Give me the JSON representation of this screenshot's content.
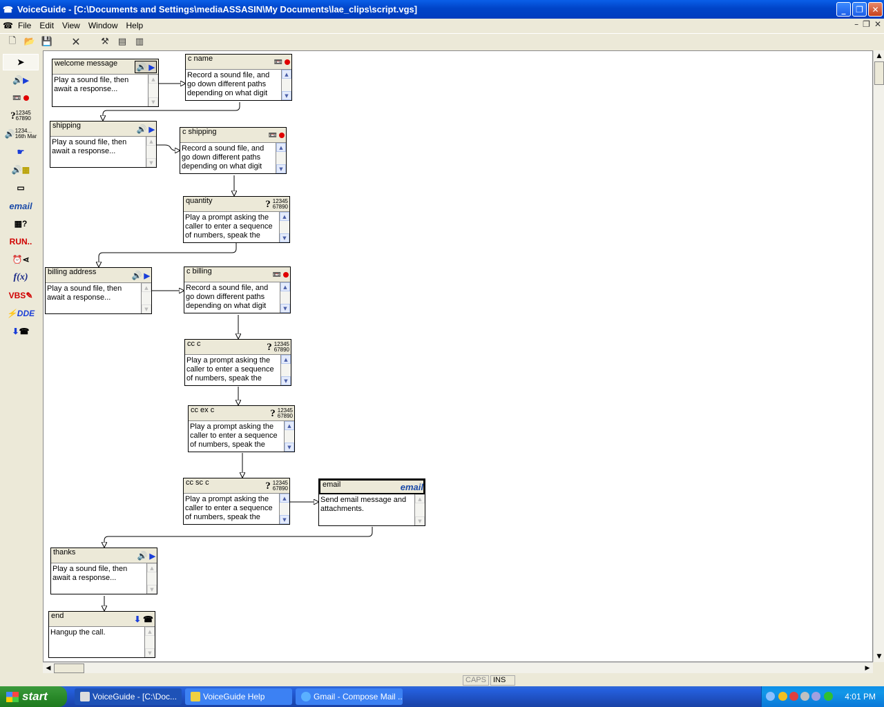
{
  "window": {
    "title": "VoiceGuide - [C:\\Documents and Settings\\mediaASSASIN\\My Documents\\lae_clips\\script.vgs]"
  },
  "menu": {
    "file": "File",
    "edit": "Edit",
    "view": "View",
    "window": "Window",
    "help": "Help"
  },
  "palette": {
    "email_label": "email",
    "run_label": "RUN..",
    "fx_label": "f(x)",
    "vbs_label": "VBS",
    "dde_label": "DDE",
    "nums_top": "12345",
    "nums_bottom": "67890",
    "time_top": "1234...",
    "time_bottom": "16th Mar"
  },
  "nodes": {
    "welcome": {
      "title": "welcome message",
      "desc": "Play a sound file, then await a response..."
    },
    "c_name": {
      "title": "c name",
      "desc": "Record a sound file, and go down different paths depending on what digit"
    },
    "shipping": {
      "title": "shipping",
      "desc": "Play a sound file, then await a response..."
    },
    "c_shipping": {
      "title": "c shipping",
      "desc": "Record a sound file, and go down different paths depending on what digit"
    },
    "quantity": {
      "title": "quantity",
      "desc": "Play a prompt asking the caller to enter a sequence of numbers, speak the"
    },
    "billing": {
      "title": "billing address",
      "desc": "Play a sound file, then await a response..."
    },
    "c_billing": {
      "title": "c billing",
      "desc": "Record a sound file, and go down different paths depending on what digit"
    },
    "cc_c": {
      "title": "cc c",
      "desc": "Play a prompt asking the caller to enter a sequence of numbers, speak the"
    },
    "cc_ex_c": {
      "title": "cc ex c",
      "desc": "Play a prompt asking the caller to enter a sequence of numbers, speak the"
    },
    "cc_sc_c": {
      "title": "cc sc c",
      "desc": "Play a prompt asking the caller to enter a sequence of numbers, speak the"
    },
    "email": {
      "title": "email",
      "desc": "Send email message and attachments.",
      "icon_label": "email"
    },
    "thanks": {
      "title": "thanks",
      "desc": "Play a sound file, then await a response..."
    },
    "end": {
      "title": "end",
      "desc": "Hangup the call."
    }
  },
  "digits": {
    "top": "12345",
    "bottom": "67890"
  },
  "status": {
    "caps": "CAPS",
    "ins": "INS"
  },
  "taskbar": {
    "start": "start",
    "tasks": [
      "VoiceGuide - [C:\\Doc...",
      "VoiceGuide Help",
      "Gmail - Compose Mail ..."
    ],
    "clock": "4:01 PM"
  },
  "colors": {
    "titlebar": "#0044c8",
    "record": "#e00000",
    "play": "#1a3ed8",
    "taskbar": "#245edb",
    "start": "#2a8a2a"
  }
}
